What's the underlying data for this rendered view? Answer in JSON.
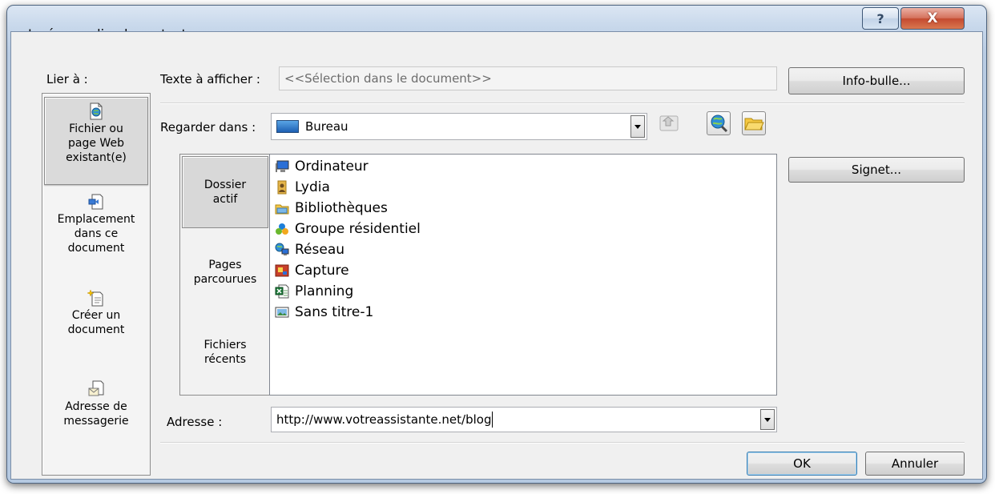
{
  "window": {
    "title": "Insérer un lien hypertexte",
    "help_glyph": "?",
    "close_glyph": "X"
  },
  "link_to": {
    "label": "Lier à :",
    "items": [
      {
        "lines": [
          "Fichier ou",
          "page Web",
          "existant(e)"
        ],
        "icon": "web-page-icon",
        "selected": true
      },
      {
        "lines": [
          "Emplacement",
          "dans ce",
          "document"
        ],
        "icon": "document-place-icon",
        "selected": false
      },
      {
        "lines": [
          "Créer un",
          "document"
        ],
        "icon": "new-document-icon",
        "selected": false
      },
      {
        "lines": [
          "Adresse de",
          "messagerie"
        ],
        "icon": "email-icon",
        "selected": false
      }
    ]
  },
  "display_text": {
    "label": "Texte à afficher :",
    "value": "<<Sélection dans le document>>"
  },
  "look_in": {
    "label": "Regarder dans :",
    "value": "Bureau",
    "icon": "desktop-icon"
  },
  "tabs": [
    {
      "lines": [
        "Dossier",
        "actif"
      ],
      "selected": true
    },
    {
      "lines": [
        "Pages",
        "parcourues"
      ],
      "selected": false
    },
    {
      "lines": [
        "Fichiers",
        "récents"
      ],
      "selected": false
    }
  ],
  "files": [
    {
      "name": "Ordinateur",
      "icon": "computer-icon"
    },
    {
      "name": "Lydia",
      "icon": "user-folder-icon"
    },
    {
      "name": "Bibliothèques",
      "icon": "libraries-icon"
    },
    {
      "name": "Groupe résidentiel",
      "icon": "homegroup-icon"
    },
    {
      "name": "Réseau",
      "icon": "network-icon"
    },
    {
      "name": "Capture",
      "icon": "image-file-icon"
    },
    {
      "name": "Planning",
      "icon": "excel-file-icon"
    },
    {
      "name": "Sans titre-1",
      "icon": "bitmap-file-icon"
    }
  ],
  "address": {
    "label": "Adresse :",
    "value": "http://www.votreassistante.net/blog"
  },
  "buttons": {
    "screentip": "Info-bulle...",
    "bookmark": "Signet...",
    "ok": "OK",
    "cancel": "Annuler"
  },
  "colors": {
    "accent": "#3c7fb1",
    "close_red": "#c44a30",
    "frame": "#b9cce3"
  }
}
